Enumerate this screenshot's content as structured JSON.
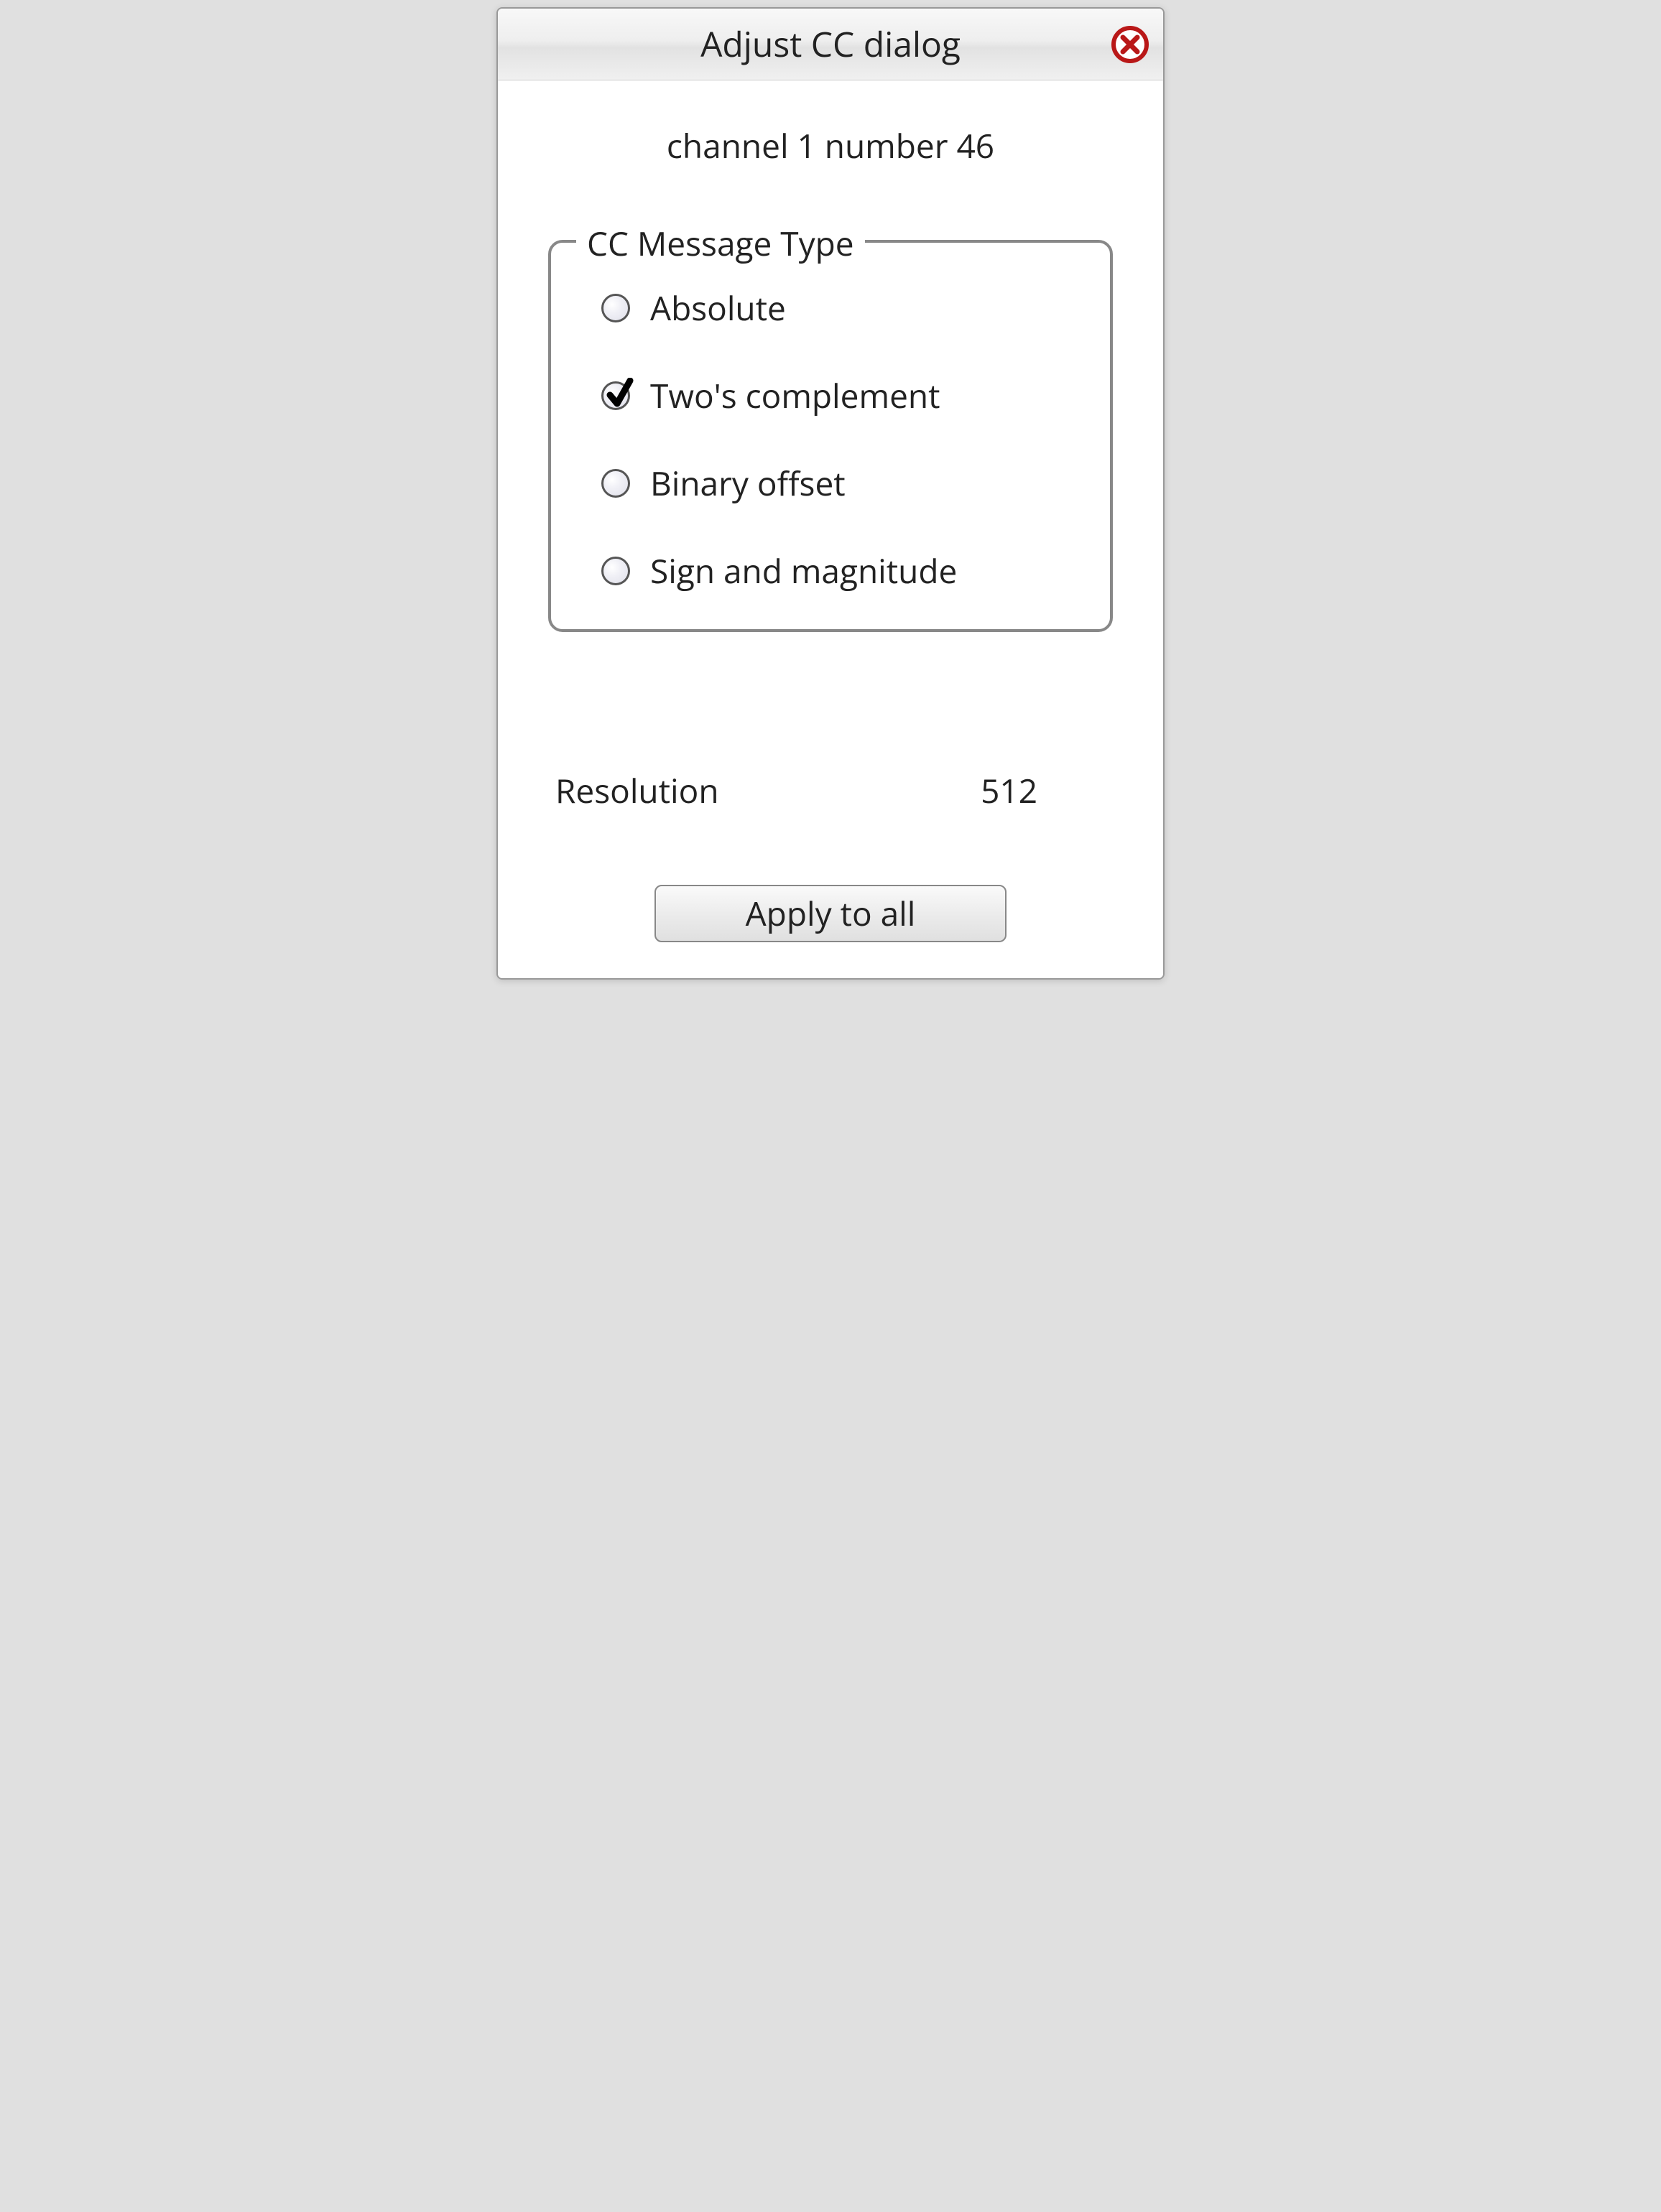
{
  "dialog": {
    "title": "Adjust CC dialog",
    "subtitle": "channel 1 number 46"
  },
  "fieldset": {
    "legend": "CC Message Type",
    "options": [
      {
        "label": "Absolute",
        "selected": false
      },
      {
        "label": "Two's complement",
        "selected": true
      },
      {
        "label": "Binary offset",
        "selected": false
      },
      {
        "label": "Sign and magnitude",
        "selected": false
      }
    ]
  },
  "resolution": {
    "label": "Resolution",
    "value": "512"
  },
  "buttons": {
    "apply_all": "Apply to all"
  }
}
